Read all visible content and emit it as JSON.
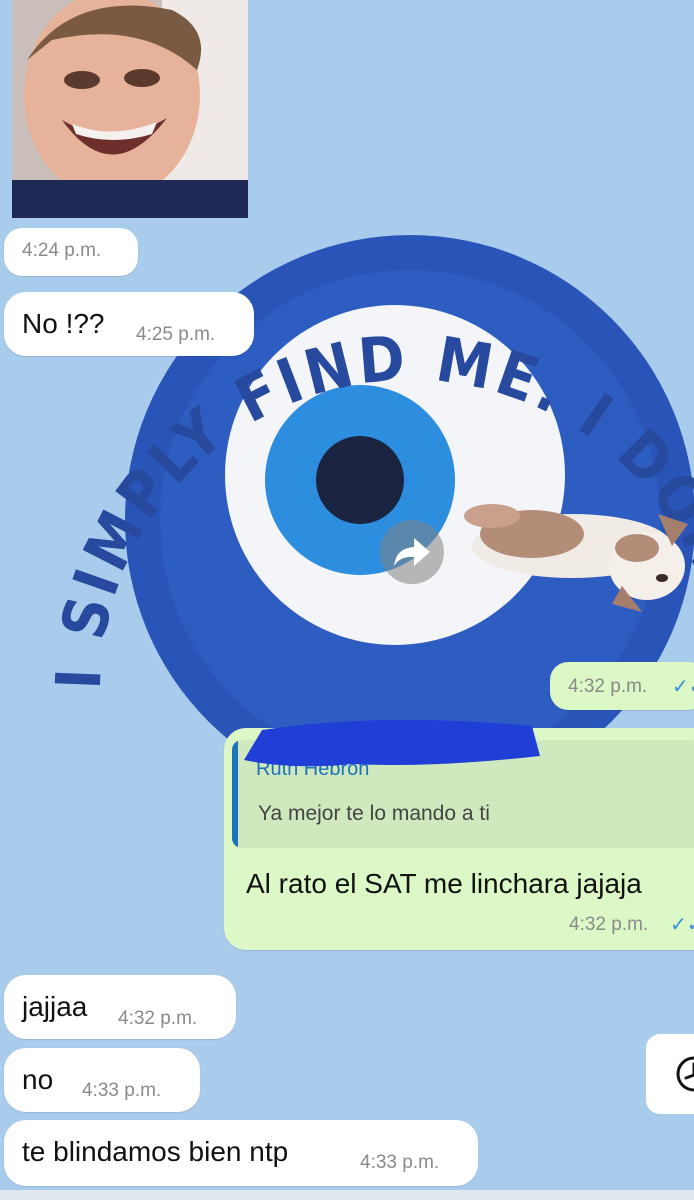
{
  "wallpaper": {
    "quote_text": "I SIMPLY FIND ME. I DON'T CHASE. I ATTRACT. WHAT BELONGS TO ME",
    "colors": {
      "background": "#a9cbec",
      "eye_outer": "#2a55b8",
      "eye_iris": "#2d8ee0",
      "eye_pupil": "#1a2340"
    }
  },
  "messages": [
    {
      "type": "incoming-photo",
      "time": "4:24 p.m."
    },
    {
      "type": "incoming",
      "text": "No !??",
      "time": "4:25 p.m."
    },
    {
      "type": "outgoing-sticker",
      "time": "4:32 p.m.",
      "status": "✓✓"
    },
    {
      "type": "outgoing-reply",
      "quote": {
        "author": "Ruth Hebron",
        "text": "Ya mejor te lo mando a ti"
      },
      "text": "Al rato el SAT me linchara jajaja",
      "time": "4:32 p.m.",
      "status": "✓✓"
    },
    {
      "type": "incoming",
      "text": "jajjaa",
      "time": "4:32 p.m."
    },
    {
      "type": "incoming",
      "text": "no",
      "time": "4:33 p.m."
    },
    {
      "type": "incoming",
      "text": "te blindamos bien ntp",
      "time": "4:33 p.m."
    }
  ],
  "icons": {
    "forward": "forward-arrow-icon",
    "read_receipt": "double-check-icon",
    "side_action": "clock-icon"
  },
  "colors": {
    "incoming_bubble": "#ffffff",
    "outgoing_bubble": "#dcf8c6",
    "read_check": "#3a8fd8",
    "quote_accent": "#1f73b9"
  }
}
